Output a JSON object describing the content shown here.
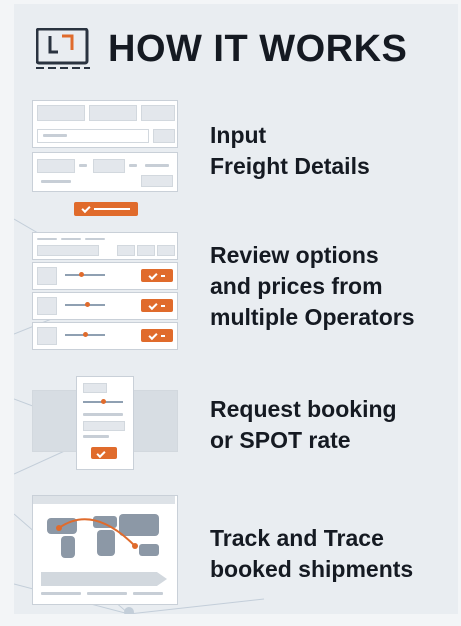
{
  "header": {
    "title": "HOW IT WORKS",
    "logo_icon": "freight-logo-icon"
  },
  "colors": {
    "accent": "#e06b2c",
    "text": "#151a22",
    "panel": "#e9edf1",
    "line": "#b9c6d2"
  },
  "steps": [
    {
      "id": "input",
      "line1": "Input",
      "line2": "Freight Details",
      "line3": "",
      "illustration": "freight-form-illustration"
    },
    {
      "id": "review",
      "line1": "Review options",
      "line2": "and prices from",
      "line3": "multiple Operators",
      "illustration": "offers-list-illustration"
    },
    {
      "id": "request",
      "line1": "Request booking",
      "line2": "or SPOT rate",
      "line3": "",
      "illustration": "booking-dialog-illustration"
    },
    {
      "id": "track",
      "line1": "Track and Trace",
      "line2": "booked shipments",
      "line3": "",
      "illustration": "world-map-tracking-illustration"
    }
  ]
}
